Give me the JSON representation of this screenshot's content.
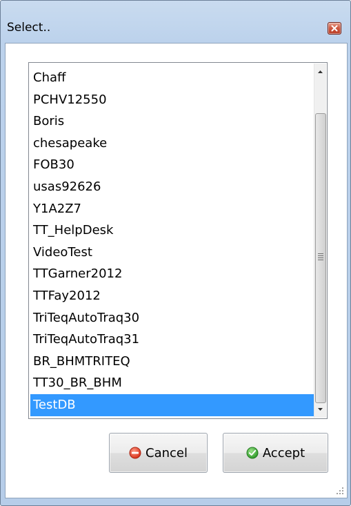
{
  "window": {
    "title": "Select.."
  },
  "list": {
    "items": [
      "Chaff",
      "PCHV12550",
      "Boris",
      "chesapeake",
      "FOB30",
      "usas92626",
      "Y1A2Z7",
      "TT_HelpDesk",
      "VideoTest",
      "TTGarner2012",
      "TTFay2012",
      "TriTeqAutoTraq30",
      "TriTeqAutoTraq31",
      "BR_BHMTRITEQ",
      "TT30_BR_BHM",
      "TestDB"
    ],
    "selected": "TestDB"
  },
  "buttons": {
    "cancel_label": "Cancel",
    "accept_label": "Accept"
  },
  "icons": {
    "close": "close-icon",
    "cancel": "minus-circle-icon",
    "accept": "check-circle-icon",
    "scroll_up": "scroll-up-arrow-icon",
    "scroll_down": "scroll-down-arrow-icon",
    "resize": "resize-grip-icon"
  },
  "colors": {
    "selection": "#3399ff",
    "window_frame": "#bcd2ec",
    "close_button": "#c94a33",
    "cancel_icon": "#e0432b",
    "accept_icon": "#3aa83a"
  }
}
